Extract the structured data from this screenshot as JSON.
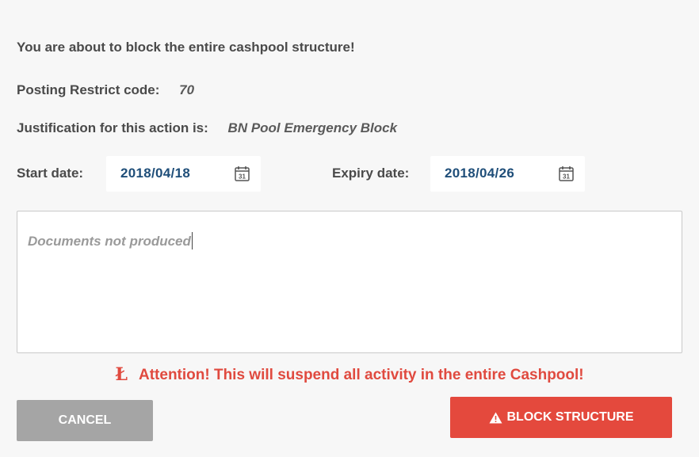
{
  "dialog": {
    "warning_title": "You are about to block the entire cashpool structure!",
    "restrict": {
      "label": "Posting Restrict code:",
      "value": "70"
    },
    "justification": {
      "label": "Justification for this action is:",
      "value": "BN Pool Emergency Block"
    },
    "start_date": {
      "label": "Start date:",
      "value": "2018/04/18",
      "icon": "calendar-icon"
    },
    "expiry_date": {
      "label": "Expiry date:",
      "value": "2018/04/26",
      "icon": "calendar-icon"
    },
    "comment": {
      "value": "Documents not produced"
    },
    "attention": {
      "icon": "Ł",
      "text": "Attention! This will suspend all activity in the entire Cashpool!"
    },
    "buttons": {
      "cancel_label": "CANCEL",
      "block_label": "BLOCK STRUCTURE",
      "block_icon": "warning-icon"
    }
  },
  "colors": {
    "background": "#f7f7f7",
    "label": "#4a4a4a",
    "date_text": "#1f4e79",
    "danger": "#e4493d",
    "cancel": "#a5a5a5"
  }
}
